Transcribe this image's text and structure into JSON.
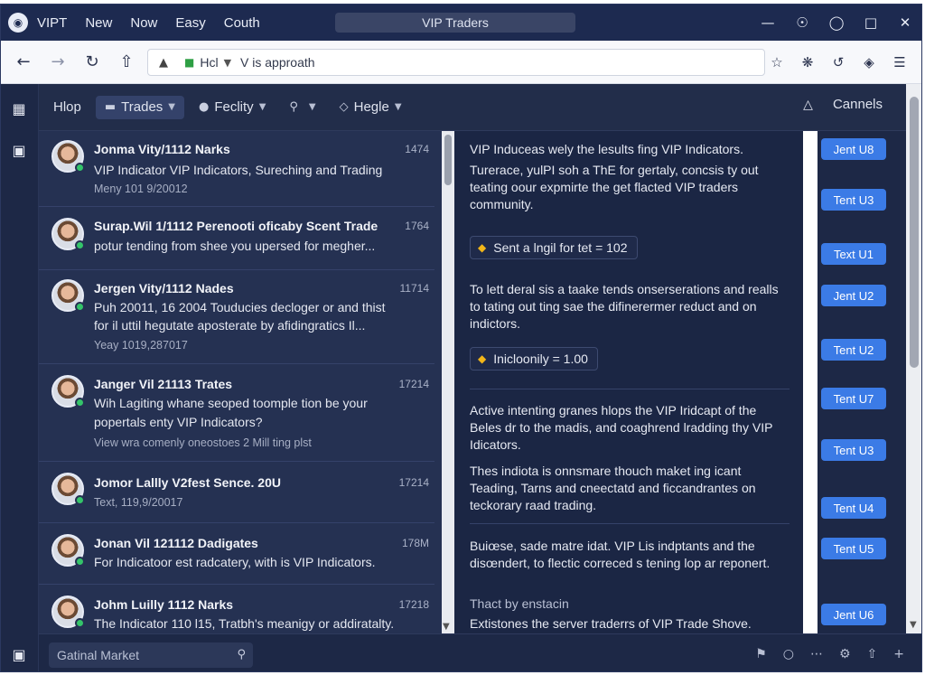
{
  "titlebar": {
    "menu": [
      "VIPT",
      "New",
      "Now",
      "Easy",
      "Couth"
    ],
    "title": "VIP Traders"
  },
  "addressbar": {
    "host": "Hcl",
    "path": "V is approath"
  },
  "toolbar": {
    "home": "Hlop",
    "trades": "Trades",
    "facility": "Feclity",
    "hegle": "Hegle",
    "channels": "Cannels"
  },
  "messages": [
    {
      "sender": "Jonma Vity/1112 Narks",
      "time": "1474",
      "lines": [
        "VIP Indicator VIP Indicators, Sureching and Trading"
      ],
      "date": "Meny 101 9/20012"
    },
    {
      "sender": "Surap.Wil 1/1112 Perenooti oficaby Scent Trade",
      "time": "1764",
      "lines": [
        "potur tending from shee you upersed for megher..."
      ],
      "date": ""
    },
    {
      "sender": "Jergen Vity/1112 Nades",
      "time": "11714",
      "lines": [
        "Puh 20011, 16 2004 Touducies decloger or and thist",
        "for il uttil hegutate aposterate by afidingratics Il..."
      ],
      "date": "Yeay 1019,287017"
    },
    {
      "sender": "Janger Vil 21113 Trates",
      "time": "17214",
      "lines": [
        "Wih Lagiting whane seoped toomple tion be your",
        "popertals enty VIP Indicators?"
      ],
      "date": "View wra comenly oneostoes 2 Mill ting plst"
    },
    {
      "sender": "Jomor Lallly V2fest Sence. 20U",
      "time": "17214",
      "lines": [],
      "date": "Text, 119,9/20017"
    },
    {
      "sender": "Jonan Vil 121112 Dadigates",
      "time": "178M",
      "lines": [
        "For Indicatoor est radcatery, with is VIP Indicators."
      ],
      "date": ""
    },
    {
      "sender": "Johm Luilly 1112 Narks",
      "time": "17218",
      "lines": [
        "The Indicator 110 l15, Tratbh's meanigy or addiratalty."
      ],
      "date": ""
    }
  ],
  "reader": {
    "p1": "VIP Induceas wely the lesults fing VIP Indicators.",
    "p2": "Turerace, yulPI soh a ThE for gertaly, concsis ty out teating oour expmirte the get flacted VIP traders community.",
    "chip1": "Sent a lngil for tet = 102",
    "p3": "To lett deral sis a taake tends onserserations and realls to tating out ting sae the difinerermer reduct and on indictors.",
    "chip2": "Inicloonily = 1.00",
    "p4": "Active intenting granes hlops the VIP Iridcapt of the Beles dr to the madis, and coaghrend lradding thy VIP Idicators.",
    "p5": "Thes indiota is onnsmare thouch maket ing icant Teading, Tarns and cneectatd and ficcandrantes on teckorary raad trading.",
    "p6": "Buiœse, sade matre idat. VIP Lis indptants and the disœndert, to flectic correced s tening lop ar reponert.",
    "p7": "Thact by enstacin",
    "p8": "Extistones the server traderrs of VIP Trade Shove."
  },
  "tags": [
    "Jent U8",
    "Tent U3",
    "Text U1",
    "Jent U2",
    "Tent U2",
    "Tent U7",
    "Tent U3",
    "Tent U4",
    "Tent U5",
    "Jent U6"
  ],
  "statusbar": {
    "search_placeholder": "Gatinal Market"
  },
  "colors": {
    "accent": "#3b7be6",
    "online": "#34c46a",
    "chip_icon": "#f2b619"
  }
}
